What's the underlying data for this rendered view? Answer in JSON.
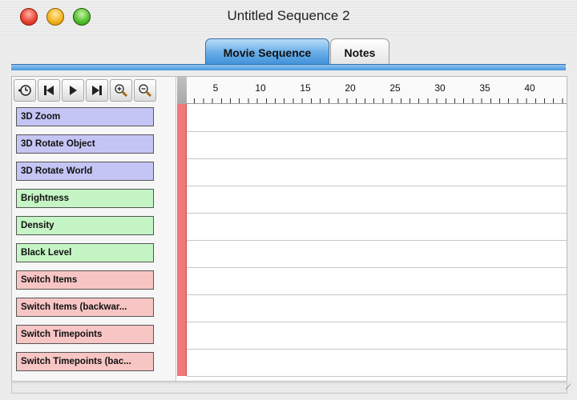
{
  "window": {
    "title": "Untitled Sequence 2"
  },
  "tabs": [
    {
      "label": "Movie Sequence",
      "active": true
    },
    {
      "label": "Notes",
      "active": false
    }
  ],
  "toolbar": {
    "buttons": [
      {
        "icon": "time-icon"
      },
      {
        "icon": "skip-to-start-icon"
      },
      {
        "icon": "play-icon"
      },
      {
        "icon": "skip-to-end-icon"
      },
      {
        "icon": "zoom-in-icon"
      },
      {
        "icon": "zoom-out-icon"
      }
    ]
  },
  "ruler": {
    "ticks": [
      "5",
      "10",
      "15",
      "20",
      "25",
      "30",
      "35",
      "40"
    ]
  },
  "tracks": [
    {
      "label": "3D Zoom",
      "color": "#c5c5f5"
    },
    {
      "label": "3D Rotate Object",
      "color": "#c5c5f5"
    },
    {
      "label": "3D Rotate World",
      "color": "#c5c5f5"
    },
    {
      "label": "Brightness",
      "color": "#c5f5c5"
    },
    {
      "label": "Density",
      "color": "#c5f5c5"
    },
    {
      "label": "Black Level",
      "color": "#c5f5c5"
    },
    {
      "label": "Switch Items",
      "color": "#f8c5c5"
    },
    {
      "label": "Switch Items (backwar...",
      "color": "#f8c5c5"
    },
    {
      "label": "Switch Timepoints",
      "color": "#f8c5c5"
    },
    {
      "label": "Switch Timepoints (bac...",
      "color": "#f8c5c5"
    }
  ],
  "colors": {
    "playhead": "#f07878",
    "tab_active": "#6aaee8"
  }
}
